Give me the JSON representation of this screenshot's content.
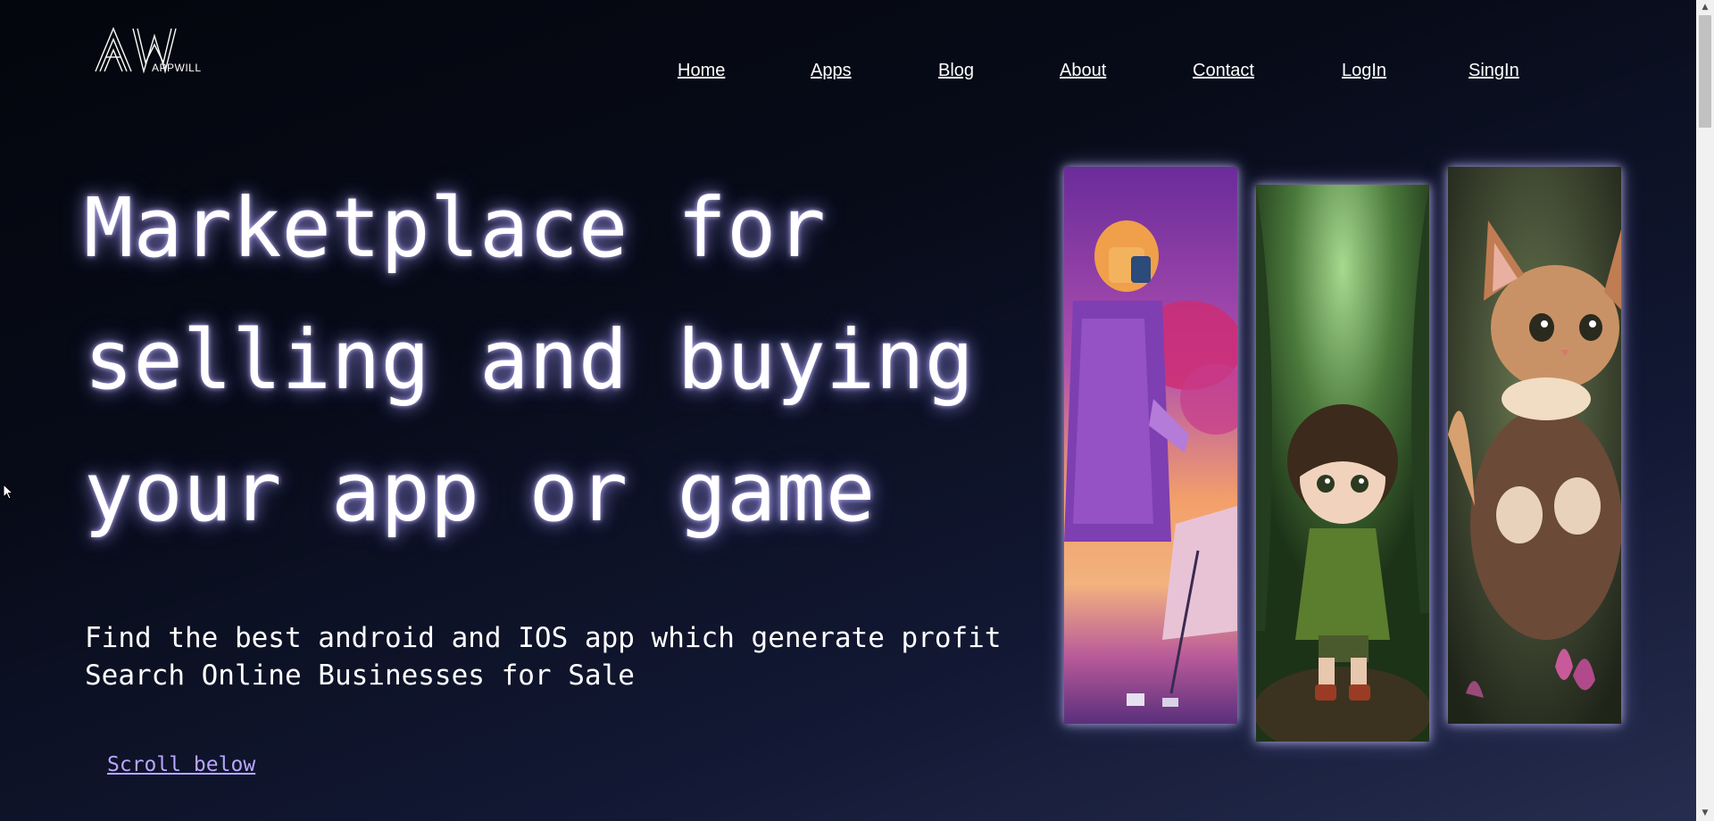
{
  "logo": {
    "text": "APPWILL"
  },
  "nav": {
    "items": [
      {
        "label": "Home"
      },
      {
        "label": "Apps"
      },
      {
        "label": "Blog"
      },
      {
        "label": "About"
      },
      {
        "label": "Contact"
      },
      {
        "label": "LogIn"
      },
      {
        "label": "SingIn"
      }
    ]
  },
  "hero": {
    "title_lines": [
      "Marketplace for",
      "selling and buying",
      "your app or game"
    ],
    "subtitle_lines": [
      "Find the best android and IOS app which generate profit",
      "Search Online Businesses for Sale"
    ],
    "scroll_label": "Scroll below"
  },
  "cards": [
    {
      "icon": "robot-painter-image"
    },
    {
      "icon": "girl-in-forest-image"
    },
    {
      "icon": "flying-cat-image"
    }
  ],
  "colors": {
    "background_dark": "#04060d",
    "background_light": "#262d4e",
    "link_text": "#ffffff",
    "scroll_link": "#b8a6ff",
    "glow": "#c8beff"
  }
}
